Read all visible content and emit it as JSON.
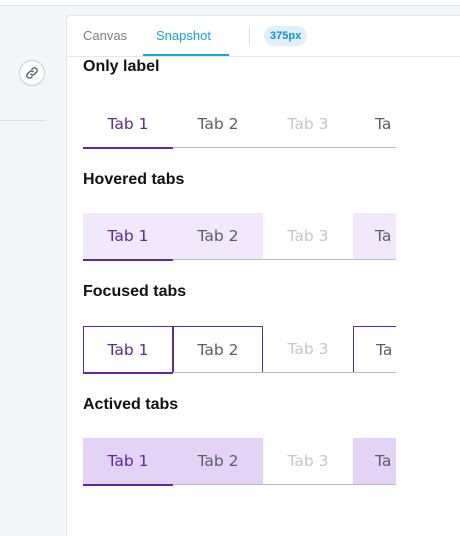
{
  "toolbar": {
    "tabs": [
      "Canvas",
      "Snapshot"
    ],
    "active_tab": "Snapshot",
    "viewport_badge": "375px"
  },
  "side": {
    "link_icon": "link-icon"
  },
  "sections": [
    {
      "title": "Only label",
      "state": "default",
      "tabs": [
        "Tab 1",
        "Tab 2",
        "Tab 3",
        "Ta"
      ]
    },
    {
      "title": "Hovered tabs",
      "state": "hovered",
      "tabs": [
        "Tab 1",
        "Tab 2",
        "Tab 3",
        "Ta"
      ]
    },
    {
      "title": "Focused tabs",
      "state": "focused",
      "tabs": [
        "Tab 1",
        "Tab 2",
        "Tab 3",
        "Ta"
      ]
    },
    {
      "title": "Actived tabs",
      "state": "actived",
      "tabs": [
        "Tab 1",
        "Tab 2",
        "Tab 3",
        "Ta"
      ]
    }
  ],
  "colors": {
    "accent": "#5c2a9d",
    "toolbar_accent": "#1aa1df",
    "hover_bg": "#f1e8fb",
    "active_bg": "#e4d3f6",
    "disabled_text": "#c4c7cc"
  }
}
